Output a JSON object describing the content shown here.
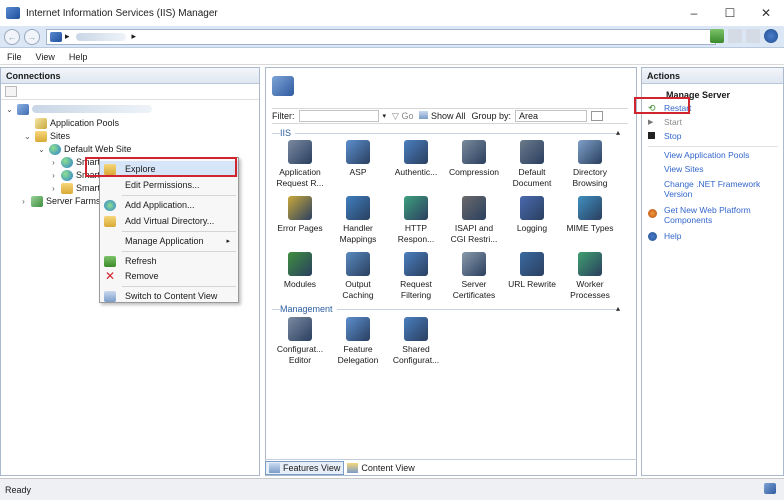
{
  "window": {
    "title": "Internet Information Services (IIS) Manager",
    "minimize": "–",
    "maximize": "☐",
    "close": "✕"
  },
  "address": {
    "separator": "▸",
    "separator2": "▸",
    "back": "←",
    "forward": "→"
  },
  "menu": [
    "File",
    "View",
    "Help"
  ],
  "connections": {
    "header": "Connections",
    "tree": {
      "application_pools": "Application Pools",
      "sites": "Sites",
      "default_web_site": "Default Web Site",
      "site1": "SmartS",
      "site2": "SmartS",
      "site3": "SmartS",
      "server_farms": "Server Farms"
    }
  },
  "context_menu": {
    "items": [
      "Explore",
      "Edit Permissions...",
      "Add Application...",
      "Add Virtual Directory...",
      "Manage Application",
      "Refresh",
      "Remove",
      "Switch to Content View"
    ],
    "submenu_arrow": "▸"
  },
  "features": {
    "filter_label": "Filter:",
    "go": "Go",
    "show_all": "Show All",
    "group_by_label": "Group by:",
    "group_by_value": "Area",
    "sections": {
      "iis": "IIS",
      "management": "Management"
    },
    "iis_items": [
      [
        "Application",
        "Request R..."
      ],
      [
        "ASP",
        ""
      ],
      [
        "Authentic...",
        ""
      ],
      [
        "Compression",
        ""
      ],
      [
        "Default",
        "Document"
      ],
      [
        "Directory",
        "Browsing"
      ],
      [
        "Error Pages",
        ""
      ],
      [
        "Handler",
        "Mappings"
      ],
      [
        "HTTP",
        "Respon..."
      ],
      [
        "ISAPI and",
        "CGI Restri..."
      ],
      [
        "Logging",
        ""
      ],
      [
        "MIME Types",
        ""
      ],
      [
        "Modules",
        ""
      ],
      [
        "Output",
        "Caching"
      ],
      [
        "Request",
        "Filtering"
      ],
      [
        "Server",
        "Certificates"
      ],
      [
        "URL Rewrite",
        ""
      ],
      [
        "Worker",
        "Processes"
      ]
    ],
    "management_items": [
      [
        "Configurat...",
        "Editor"
      ],
      [
        "Feature",
        "Delegation"
      ],
      [
        "Shared",
        "Configurat..."
      ]
    ],
    "tabs": {
      "features_view": "Features View",
      "content_view": "Content View"
    }
  },
  "actions": {
    "header": "Actions",
    "title": "Manage Server",
    "restart": "Restart",
    "start": "Start",
    "stop": "Stop",
    "view_app_pools": "View Application Pools",
    "view_sites": "View Sites",
    "change_net": "Change .NET Framework Version",
    "get_platform": "Get New Web Platform Components",
    "help": "Help"
  },
  "status": {
    "text": "Ready"
  }
}
